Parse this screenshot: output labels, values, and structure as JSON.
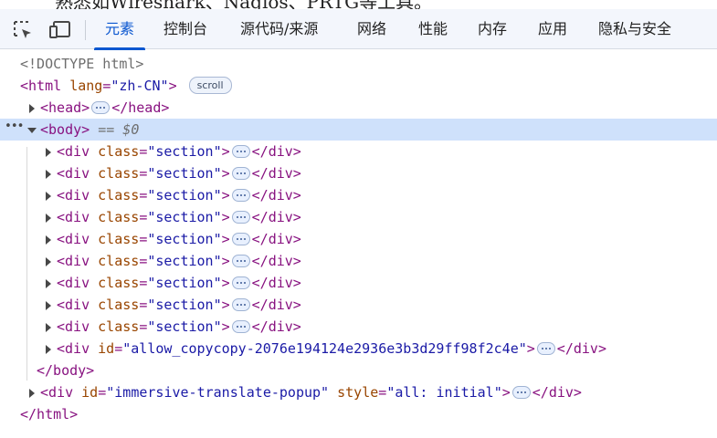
{
  "page_peek_text": "熟悉如Wireshark、Nagios、PRTG等工具。",
  "toolbar": {
    "inspect_label": "",
    "device_label": "",
    "tabs": [
      {
        "label": "元素",
        "active": true
      },
      {
        "label": "控制台",
        "active": false
      },
      {
        "label": "源代码/来源",
        "active": false
      },
      {
        "label": "网络",
        "active": false
      },
      {
        "label": "性能",
        "active": false
      },
      {
        "label": "内存",
        "active": false
      },
      {
        "label": "应用",
        "active": false
      },
      {
        "label": "隐私与安全",
        "active": false
      }
    ]
  },
  "dom": {
    "doctype": "<!DOCTYPE html>",
    "html_open": "<html",
    "html_lang_attr": "lang",
    "html_lang_val": "\"zh-CN\"",
    "html_close_bracket": ">",
    "scroll_badge": "scroll",
    "head_open": "<head>",
    "head_close": "</head>",
    "body_open": "<body>",
    "body_eq": "== $0",
    "div_open": "<div",
    "class_attr": "class",
    "section_val": "\"section\"",
    "div_close": "</div>",
    "section_count": 9,
    "id_attr": "id",
    "copy_id_val": "\"allow_copycopy-2076e194124e2936e3b3d29ff98f2c4e\"",
    "body_close": "</body>",
    "popup_id_val": "\"immersive-translate-popup\"",
    "style_attr": "style",
    "style_val": "\"all: initial\"",
    "html_close": "</html>",
    "equals": "=",
    "gt": ">"
  },
  "colors": {
    "tag": "#881280",
    "attr": "#994500",
    "value": "#1a1aa6",
    "active_tab": "#0b57d0",
    "selected_row": "#cfe1fb"
  }
}
